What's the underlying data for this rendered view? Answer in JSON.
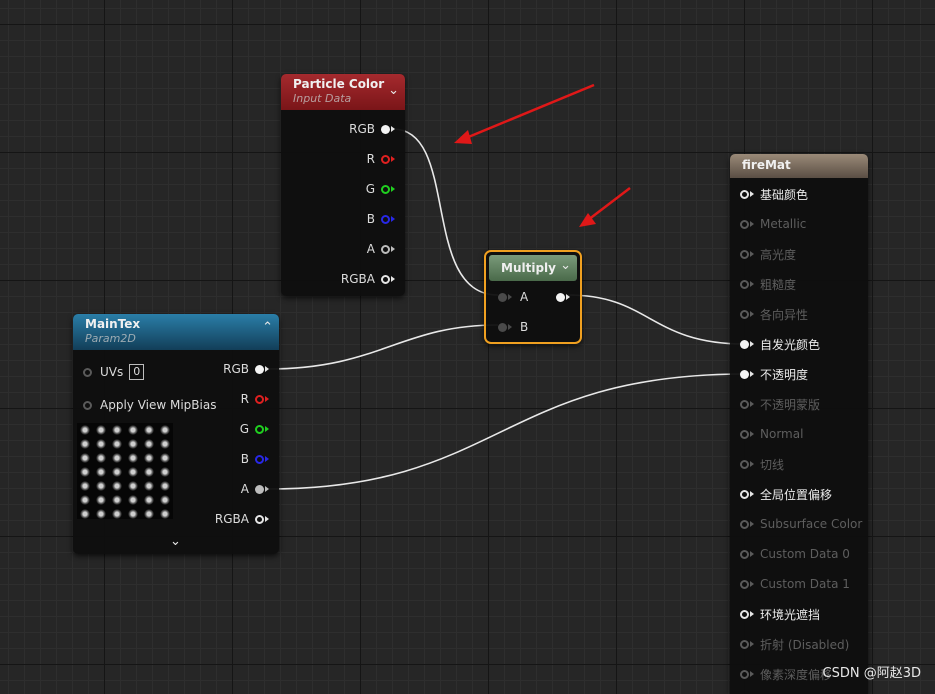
{
  "particle_color": {
    "title": "Particle Color",
    "subtitle": "Input Data",
    "pins": [
      "RGB",
      "R",
      "G",
      "B",
      "A",
      "RGBA"
    ]
  },
  "multiply": {
    "title": "Multiply",
    "inputs": [
      "A",
      "B"
    ]
  },
  "maintex": {
    "title": "MainTex",
    "subtitle": "Param2D",
    "uvs_label": "UVs",
    "uvs_value": "0",
    "mipbias_label": "Apply View MipBias",
    "pins": [
      "RGB",
      "R",
      "G",
      "B",
      "A",
      "RGBA"
    ]
  },
  "material": {
    "title": "fireMat",
    "pins": [
      {
        "label": "基础颜色",
        "enabled": true
      },
      {
        "label": "Metallic",
        "enabled": false
      },
      {
        "label": "高光度",
        "enabled": false
      },
      {
        "label": "粗糙度",
        "enabled": false
      },
      {
        "label": "各向异性",
        "enabled": false
      },
      {
        "label": "自发光颜色",
        "enabled": true
      },
      {
        "label": "不透明度",
        "enabled": true
      },
      {
        "label": "不透明蒙版",
        "enabled": false
      },
      {
        "label": "Normal",
        "enabled": false
      },
      {
        "label": "切线",
        "enabled": false
      },
      {
        "label": "全局位置偏移",
        "enabled": true
      },
      {
        "label": "Subsurface Color",
        "enabled": false
      },
      {
        "label": "Custom Data 0",
        "enabled": false
      },
      {
        "label": "Custom Data 1",
        "enabled": false
      },
      {
        "label": "环境光遮挡",
        "enabled": true
      },
      {
        "label": "折射 (Disabled)",
        "enabled": false
      },
      {
        "label": "像素深度偏移",
        "enabled": false
      }
    ]
  },
  "colors": {
    "particle_header": "#8a1a1e",
    "maintex_header": "#1c5a7a",
    "multiply_header": "#5a7a5a",
    "material_header": "#7a6a5a",
    "selection": "#f0a020",
    "pin_r": "#e02020",
    "pin_g": "#20d020",
    "pin_b": "#2020e0",
    "arrow": "#e01818"
  },
  "watermark": "CSDN @阿赵3D"
}
